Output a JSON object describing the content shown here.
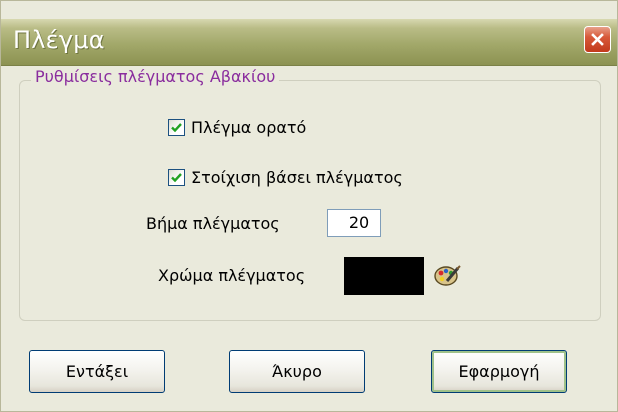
{
  "window": {
    "title": "Πλέγμα"
  },
  "group": {
    "label": "Ρυθμίσεις πλέγματος Αβακίου"
  },
  "grid_visible": {
    "label": "Πλέγμα ορατό",
    "checked": true
  },
  "snap_to_grid": {
    "label": "Στοίχιση βάσει πλέγματος",
    "checked": true
  },
  "grid_step": {
    "label": "Βήμα πλέγματος",
    "value": "20"
  },
  "grid_color": {
    "label": "Χρώμα πλέγματος",
    "value": "#000000"
  },
  "buttons": {
    "ok": "Εντάξει",
    "cancel": "Άκυρο",
    "apply": "Εφαρμογή"
  },
  "colors": {
    "titlebar": "#a2a86a",
    "group_label": "#8a2d9e",
    "close_button": "#d8593a"
  }
}
